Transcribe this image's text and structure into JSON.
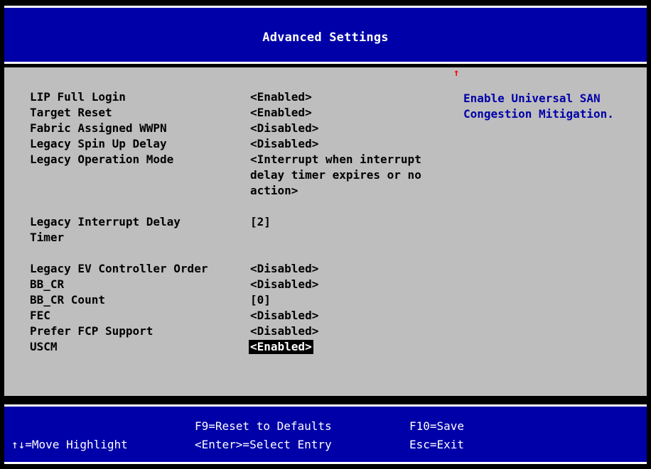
{
  "header": {
    "title": "Advanced Settings"
  },
  "settings": [
    {
      "label": "LIP Full Login",
      "value": "<Enabled>"
    },
    {
      "label": "Target Reset",
      "value": "<Enabled>"
    },
    {
      "label": "Fabric Assigned WWPN",
      "value": "<Disabled>"
    },
    {
      "label": "Legacy Spin Up Delay",
      "value": "<Disabled>"
    },
    {
      "label": "Legacy Operation Mode",
      "value": "<Interrupt when interrupt",
      "value2": "delay timer expires or no",
      "value3": "action>"
    },
    {
      "label": "Legacy Interrupt Delay",
      "label2": "Timer",
      "value": "[2]"
    },
    {
      "label": "Legacy EV Controller Order",
      "value": "<Disabled>"
    },
    {
      "label": "BB_CR",
      "value": "<Disabled>"
    },
    {
      "label": "BB_CR Count",
      "value": "[0]"
    },
    {
      "label": "FEC",
      "value": "<Disabled>"
    },
    {
      "label": "Prefer FCP Support",
      "value": "<Disabled>"
    },
    {
      "label": "USCM",
      "value": "<Enabled>"
    }
  ],
  "help": {
    "line1": "Enable Universal SAN",
    "line2": "Congestion Mitigation."
  },
  "scroll_indicator": "↑",
  "footer": {
    "move": "↑↓=Move Highlight",
    "reset": "F9=Reset to Defaults",
    "select": "<Enter>=Select Entry",
    "save": "F10=Save",
    "exit": "Esc=Exit"
  },
  "colors": {
    "title_bg": "#0000a8",
    "body_bg": "#bebebe",
    "help_text": "#0000a8",
    "scroll_arrow": "#ff0000"
  }
}
